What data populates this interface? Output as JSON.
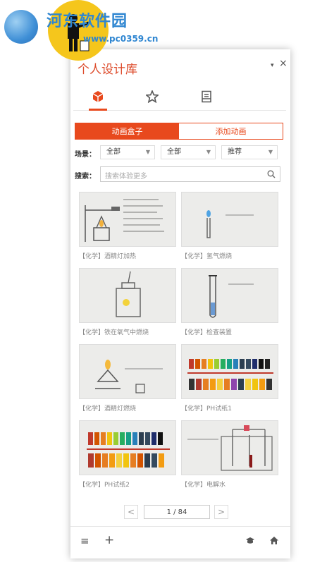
{
  "watermark": {
    "site_name": "河东软件园",
    "url": "www.pc0359.cn"
  },
  "panel": {
    "title": "个人设计库",
    "menu_icon": "▾",
    "close_icon": "×"
  },
  "icon_tabs": [
    {
      "name": "tab-cube",
      "icon": "cube-icon"
    },
    {
      "name": "tab-favorites",
      "icon": "star-icon"
    },
    {
      "name": "tab-document",
      "icon": "document-icon"
    }
  ],
  "segment": {
    "left": "动画盒子",
    "right": "添加动画"
  },
  "filters": {
    "scene_label": "场景：",
    "d1": "全部",
    "d2": "全部",
    "d3": "推荐",
    "search_label": "搜索：",
    "search_placeholder": "搜索体验更多"
  },
  "items": [
    {
      "caption": "【化学】酒精灯加热"
    },
    {
      "caption": "【化学】氢气燃烧"
    },
    {
      "caption": "【化学】铁在氧气中燃烧"
    },
    {
      "caption": "【化学】检查装置"
    },
    {
      "caption": "【化学】酒精灯燃烧"
    },
    {
      "caption": "【化学】PH试纸1"
    },
    {
      "caption": "【化学】PH试纸2"
    },
    {
      "caption": "【化学】电解水"
    }
  ],
  "pager": {
    "prev": "<",
    "next": ">",
    "page": "1 / 84"
  },
  "footer": {
    "menu_icon": "≡",
    "add_icon": "+",
    "hat_icon": "graduation-cap-icon",
    "home_icon": "home-icon"
  },
  "colors": {
    "accent": "#e8491d",
    "title": "#dd4b2b"
  }
}
